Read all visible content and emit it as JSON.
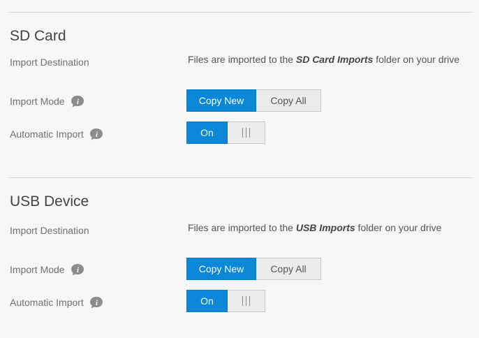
{
  "sections": [
    {
      "title": "SD Card",
      "import_destination_label": "Import Destination",
      "destination_prefix": "Files are imported to the ",
      "destination_folder": "SD Card Imports",
      "destination_suffix": " folder on your drive",
      "import_mode_label": "Import Mode",
      "mode_options": [
        "Copy New",
        "Copy All"
      ],
      "selected_mode": "Copy New",
      "automatic_import_label": "Automatic Import",
      "automatic_import_state": "On"
    },
    {
      "title": "USB Device",
      "import_destination_label": "Import Destination",
      "destination_prefix": "Files are imported to the ",
      "destination_folder": "USB Imports",
      "destination_suffix": " folder on your drive",
      "import_mode_label": "Import Mode",
      "mode_options": [
        "Copy New",
        "Copy All"
      ],
      "selected_mode": "Copy New",
      "automatic_import_label": "Automatic Import",
      "automatic_import_state": "On"
    }
  ],
  "icons": {
    "info": "info-icon",
    "toggle_handle": "grip-icon"
  },
  "colors": {
    "accent": "#0a87d8",
    "background": "#f7f7f7",
    "inactive_button": "#ececec",
    "divider": "#d6d6d6"
  }
}
